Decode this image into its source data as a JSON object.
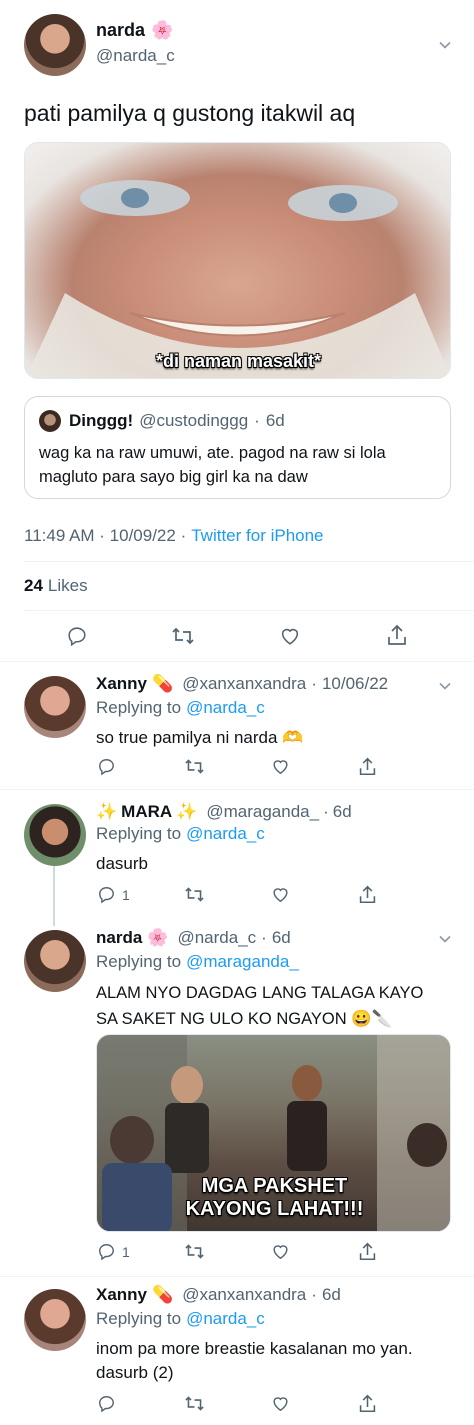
{
  "main": {
    "name": "narda",
    "name_emoji": "🌸",
    "handle": "@narda_c",
    "text": "pati pamilya q gustong itakwil aq",
    "image_caption": "*di naman masakit*",
    "quote": {
      "name": "Dinggg!",
      "handle": "@custodinggg",
      "sep": "·",
      "time": "6d",
      "text": "wag ka na raw umuwi, ate. pagod na raw si lola magluto para sayo big girl ka na daw"
    },
    "timestamp": "11:49 AM · 10/09/22 ·",
    "source": "Twitter for iPhone",
    "likes_count": "24",
    "likes_label": "Likes"
  },
  "replies": [
    {
      "name": "Xanny",
      "emoji": "💊",
      "handle": "@xanxanxandra",
      "sep": "·",
      "time": "10/06/22",
      "replying_label": "Replying to",
      "replying_to": "@narda_c",
      "text": "so true pamilya ni narda 🫶",
      "reply_count": ""
    },
    {
      "name_prefix": "✨",
      "name": "MARA",
      "name_suffix": "✨",
      "handle": "@maraganda_",
      "sep": "·",
      "time": "6d",
      "replying_label": "Replying to",
      "replying_to": "@narda_c",
      "text": "dasurb",
      "reply_count": "1"
    },
    {
      "name": "narda",
      "emoji": "🌸",
      "handle": "@narda_c",
      "sep": "·",
      "time": "6d",
      "replying_label": "Replying to",
      "replying_to": "@maraganda_",
      "text_line1": "ALAM NYO DAGDAG LANG TALAGA KAYO",
      "text_line2": "SA SAKET NG ULO KO NGAYON 😀🔪",
      "image_caption_line1": "MGA PAKSHET",
      "image_caption_line2": "KAYONG LAHAT!!!",
      "reply_count": "1"
    },
    {
      "name": "Xanny",
      "emoji": "💊",
      "handle": "@xanxanxandra",
      "sep": "·",
      "time": "6d",
      "replying_label": "Replying to",
      "replying_to": "@narda_c",
      "text_line1": "inom pa more breastie kasalanan mo yan.",
      "text_line2": "dasurb (2)",
      "reply_count": ""
    }
  ],
  "colors": {
    "accent": "#1d9bf0",
    "muted": "#536471",
    "divider": "#eff3f4"
  },
  "icons": [
    "reply-icon",
    "retweet-icon",
    "like-icon",
    "share-icon",
    "chevron-down-icon"
  ]
}
